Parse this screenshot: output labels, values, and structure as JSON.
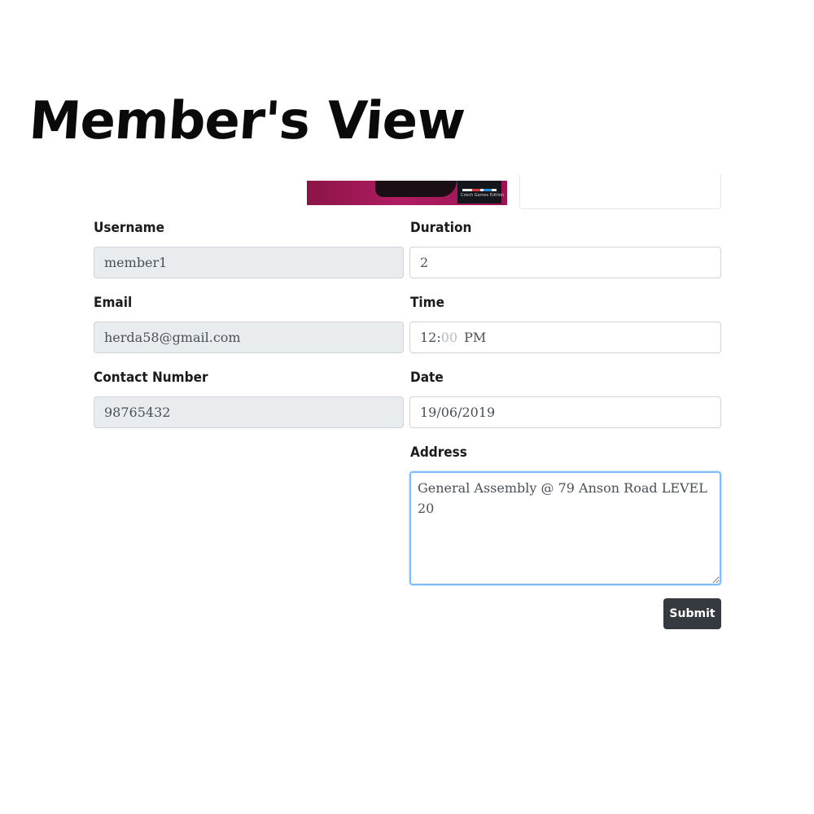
{
  "page": {
    "heading": "Member's View"
  },
  "game_image": {
    "logo_caption": "Czech Games Edition"
  },
  "form": {
    "username": {
      "label": "Username",
      "value": "member1"
    },
    "email": {
      "label": "Email",
      "value": "herda58@gmail.com"
    },
    "contact": {
      "label": "Contact Number",
      "value": "98765432"
    },
    "duration": {
      "label": "Duration",
      "value": "2"
    },
    "time": {
      "label": "Time",
      "hour": "12",
      "separator": ":",
      "minute": "00",
      "period": "PM"
    },
    "date": {
      "label": "Date",
      "value": "19/06/2019"
    },
    "address": {
      "label": "Address",
      "value": "General Assembly @ 79 Anson Road LEVEL 20"
    },
    "submit_label": "Submit"
  },
  "colors": {
    "readonly_bg": "#e9ecef",
    "focus_border": "#80bdff",
    "button_bg": "#343a40",
    "image_bg": "#b01c62"
  }
}
